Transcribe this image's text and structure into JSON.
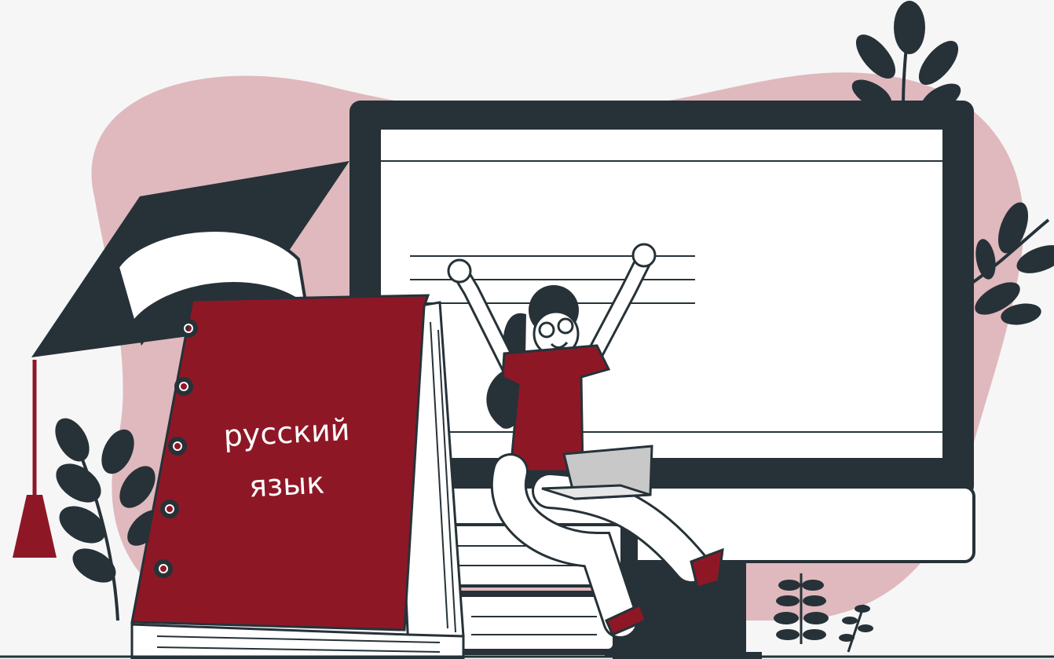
{
  "book": {
    "title_line1": "русский",
    "title_line2": "язык"
  },
  "colors": {
    "background": "#f6f6f6",
    "blob": "#dfb9bd",
    "dark": "#263238",
    "accent": "#8e1726",
    "white": "#ffffff",
    "laptop": "#c8c8c8"
  }
}
